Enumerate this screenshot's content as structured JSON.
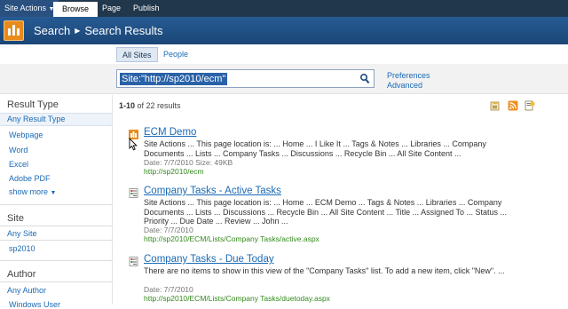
{
  "ribbon": {
    "site_actions": "Site Actions",
    "tabs": [
      "Browse",
      "Page",
      "Publish"
    ]
  },
  "titlebar": {
    "crumb1": "Search",
    "crumb2": "Search Results"
  },
  "scopes": [
    "All Sites",
    "People"
  ],
  "search": {
    "query": "Site:\"http://sp2010/ecm\"",
    "preferences": "Preferences",
    "advanced": "Advanced"
  },
  "results_count": {
    "range": "1-10",
    "rest": " of 22 results"
  },
  "refinements": {
    "result_type": {
      "heading": "Result Type",
      "items": [
        "Any Result Type",
        "Webpage",
        "Word",
        "Excel",
        "Adobe PDF",
        "show more"
      ]
    },
    "site": {
      "heading": "Site",
      "items": [
        "Any Site",
        "sp2010"
      ]
    },
    "author": {
      "heading": "Author",
      "items": [
        "Any Author",
        "Windows User"
      ]
    }
  },
  "results": [
    {
      "title": "ECM Demo",
      "desc": "Site Actions ... This page location is: ... Home ... I Like It ... Tags & Notes ... Libraries ... Company Documents ... Lists ... Company Tasks ... Discussions ... Recycle Bin ... All Site Content ...",
      "meta": "Date: 7/7/2010   Size: 49KB",
      "url": "http://sp2010/ecm"
    },
    {
      "title": "Company Tasks - Active Tasks",
      "desc": "Site Actions ... This page location is: ... Home ... ECM Demo ... Tags & Notes ... Libraries ... Company Documents ... Lists ... Discussions ... Recycle Bin ... All Site Content ... Title ... Assigned To ... Status ... Priority ... Due Date ... Review ... John ...",
      "meta": "Date: 7/7/2010",
      "url": "http://sp2010/ECM/Lists/Company Tasks/active.aspx"
    },
    {
      "title": "Company Tasks - Due Today",
      "desc": "There are no items to show in this view of the \"Company Tasks\" list. To add a new item, click \"New\". ...",
      "meta": "Date: 7/7/2010",
      "url": "http://sp2010/ECM/Lists/Company Tasks/duetoday.aspx"
    }
  ],
  "colors": {
    "ribbon": "#21374c",
    "titlebar": "#1f4c7c",
    "link": "#1b6ab5",
    "url": "#338a1b"
  }
}
